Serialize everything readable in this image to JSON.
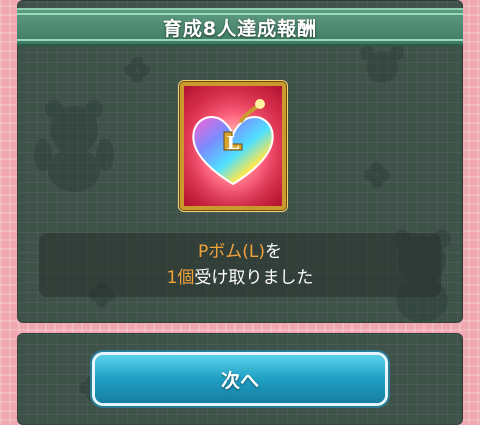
{
  "title": "育成8人達成報酬",
  "reward": {
    "item_name": "Pボム(L)",
    "item_suffix": "を",
    "count": "1個",
    "message_rest": "受け取りました",
    "icon": "rainbow-heart-bomb-icon",
    "icon_letter": "L"
  },
  "buttons": {
    "next_label": "次へ"
  },
  "colors": {
    "accent_orange": "#f2a23a",
    "title_green": "#4a8a72",
    "button_blue": "#1f9fc4",
    "panel_bg": "#3e524a",
    "pink_bg": "#f0a7b0"
  }
}
